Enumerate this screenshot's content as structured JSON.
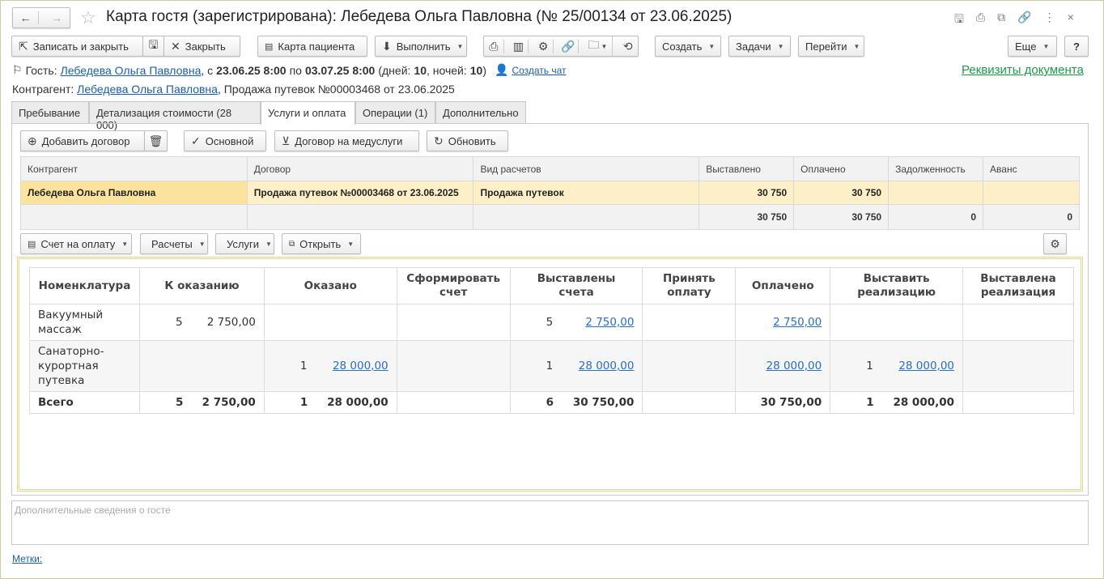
{
  "window": {
    "title": "Карта гостя (зарегистрирована): Лебедева Ольга Павловна (№ 25/00134 от 23.06.2025)"
  },
  "toolbar": {
    "save_close": "Записать и закрыть",
    "close": "Закрыть",
    "patient_card": "Карта пациента",
    "execute": "Выполнить",
    "create": "Создать",
    "tasks": "Задачи",
    "goto": "Перейти",
    "more": "Еще",
    "help": "?"
  },
  "guest": {
    "label": "Гость:",
    "name": "Лебедева Ольга Павловна",
    "from_label": ", с",
    "from": "23.06.25 8:00",
    "to_label": "по",
    "to": "03.07.25 8:00",
    "days_label": "(дней:",
    "days": "10",
    "nights_label": ", ночей:",
    "nights": "10",
    "close_paren": ")",
    "chat": "Создать чат"
  },
  "doc_requisites": "Реквизиты документа",
  "counterparty": {
    "label": "Контрагент:",
    "name": "Лебедева Ольга Павловна",
    "rest": ", Продажа путевок №00003468 от 23.06.2025"
  },
  "tabs": [
    "Пребывание",
    "Детализация стоимости (28 000)",
    "Услуги и оплата",
    "Операции (1)",
    "Дополнительно"
  ],
  "contracts_toolbar": {
    "add": "Добавить договор",
    "main": "Основной",
    "med": "Договор на медуслуги",
    "refresh": "Обновить"
  },
  "contracts": {
    "headers": [
      "Контрагент",
      "Договор",
      "Вид расчетов",
      "Выставлено",
      "Оплачено",
      "Задолженность",
      "Аванс"
    ],
    "row": [
      "Лебедева Ольга Павловна",
      "Продажа путевок №00003468 от 23.06.2025",
      "Продажа путевок",
      "30 750",
      "30 750",
      "",
      ""
    ],
    "totals": [
      "",
      "",
      "",
      "30 750",
      "30 750",
      "0",
      "0"
    ]
  },
  "services_toolbar": {
    "invoice": "Счет на оплату",
    "settlements": "Расчеты",
    "services": "Услуги",
    "open": "Открыть"
  },
  "services": {
    "headers": [
      "Номенклатура",
      "К оказанию",
      "Оказано",
      "Сформировать счет",
      "Выставлены счета",
      "Принять оплату",
      "Оплачено",
      "Выставить реализацию",
      "Выставлена реализация"
    ],
    "rows": [
      {
        "name": "Вакуумный массаж",
        "to_q": "5",
        "to_s": "2 750,00",
        "done_q": "",
        "done_s": "",
        "inv_q": "5",
        "inv_s": "2 750,00",
        "paid": "2 750,00",
        "real_q": "",
        "real_s": ""
      },
      {
        "name": "Санаторно-курортная путевка",
        "to_q": "",
        "to_s": "",
        "done_q": "1",
        "done_s": "28 000,00",
        "inv_q": "1",
        "inv_s": "28 000,00",
        "paid": "28 000,00",
        "real_q": "1",
        "real_s": "28 000,00"
      }
    ],
    "total": {
      "name": "Всего",
      "to_q": "5",
      "to_s": "2 750,00",
      "done_q": "1",
      "done_s": "28 000,00",
      "inv_q": "6",
      "inv_s": "30 750,00",
      "paid": "30 750,00",
      "real_q": "1",
      "real_s": "28 000,00"
    }
  },
  "extra_info_placeholder": "Дополнительные сведения о госте",
  "tags_link": "Метки:"
}
